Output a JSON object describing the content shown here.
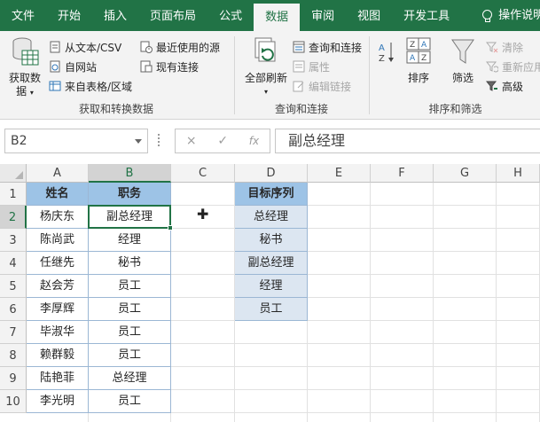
{
  "tabs": [
    {
      "label": "文件",
      "active": false
    },
    {
      "label": "开始",
      "active": false
    },
    {
      "label": "插入",
      "active": false
    },
    {
      "label": "页面布局",
      "active": false
    },
    {
      "label": "公式",
      "active": false
    },
    {
      "label": "数据",
      "active": true
    },
    {
      "label": "审阅",
      "active": false
    },
    {
      "label": "视图",
      "active": false
    },
    {
      "label": "开发工具",
      "active": false
    }
  ],
  "help_label": "操作说明搜",
  "ribbon": {
    "get_data": {
      "big_label_1": "获取数",
      "big_label_2": "据",
      "from_text_csv": "从文本/CSV",
      "from_web": "自网站",
      "from_table": "来自表格/区域",
      "recent_sources": "最近使用的源",
      "existing_connections": "现有连接",
      "group_label": "获取和转换数据"
    },
    "queries": {
      "refresh_all": "全部刷新",
      "queries_connections": "查询和连接",
      "properties": "属性",
      "edit_links": "编辑链接",
      "group_label": "查询和连接"
    },
    "sort_filter": {
      "sort": "排序",
      "filter": "筛选",
      "clear": "清除",
      "reapply": "重新应用",
      "advanced": "高级",
      "group_label": "排序和筛选"
    }
  },
  "formula_bar": {
    "name_box": "B2",
    "cancel_icon": "×",
    "enter_icon": "✓",
    "fx_icon": "fx",
    "value": "副总经理"
  },
  "columns": [
    "A",
    "B",
    "C",
    "D",
    "E",
    "F",
    "G",
    "H"
  ],
  "rows": [
    "1",
    "2",
    "3",
    "4",
    "5",
    "6",
    "7",
    "8",
    "9",
    "10"
  ],
  "selected_cell": {
    "column": "B",
    "row": "2"
  },
  "table1": {
    "headers": [
      "姓名",
      "职务"
    ],
    "rows": [
      [
        "杨庆东",
        "副总经理"
      ],
      [
        "陈尚武",
        "经理"
      ],
      [
        "任继先",
        "秘书"
      ],
      [
        "赵会芳",
        "员工"
      ],
      [
        "李厚辉",
        "员工"
      ],
      [
        "毕淑华",
        "员工"
      ],
      [
        "赖群毅",
        "员工"
      ],
      [
        "陆艳菲",
        "总经理"
      ],
      [
        "李光明",
        "员工"
      ]
    ]
  },
  "table2": {
    "header": "目标序列",
    "items": [
      "总经理",
      "秘书",
      "副总经理",
      "经理",
      "员工"
    ]
  },
  "colors": {
    "excel_green": "#217346",
    "header_fill": "#9dc3e6",
    "light_fill": "#dce6f1"
  }
}
